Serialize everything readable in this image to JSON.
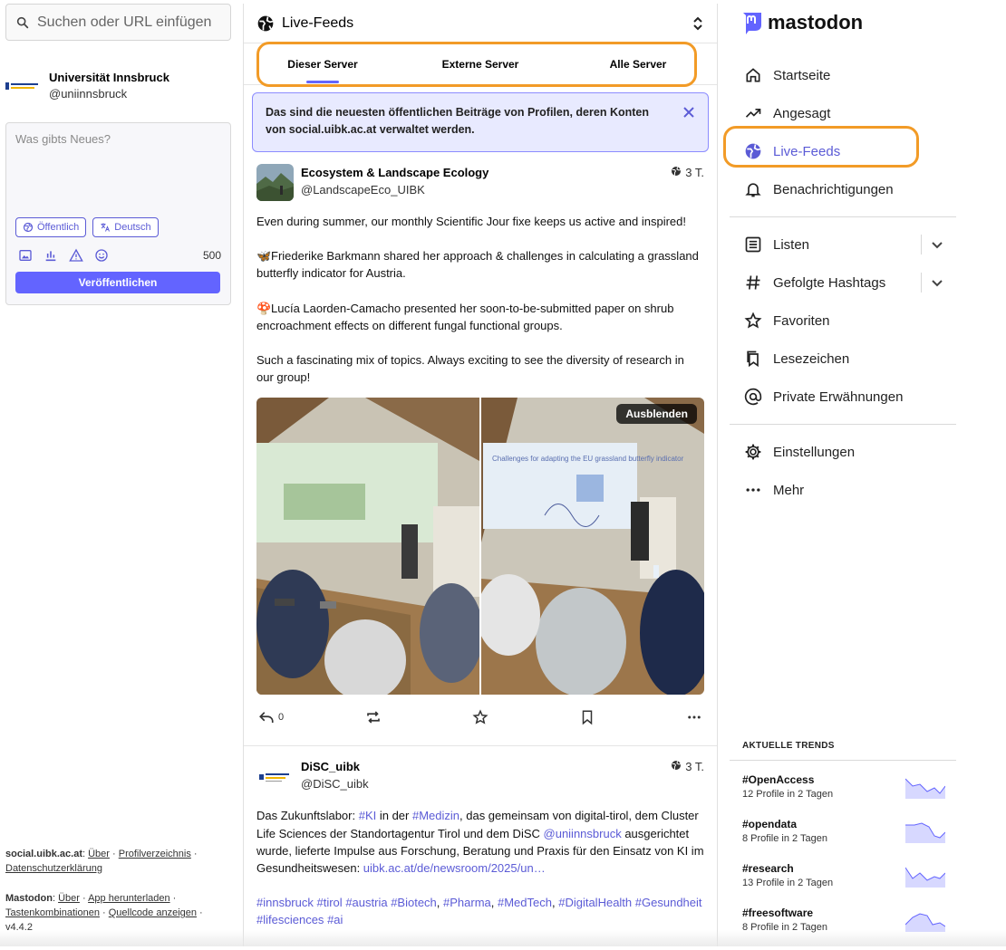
{
  "search": {
    "placeholder": "Suchen oder URL einfügen"
  },
  "account": {
    "name": "Universität Innsbruck",
    "handle": "@uniinnsbruck",
    "logo_text": "universität innsbruck"
  },
  "compose": {
    "placeholder": "Was gibts Neues?",
    "visibility_label": "Öffentlich",
    "language_label": "Deutsch",
    "char_count": "500",
    "publish_label": "Veröffentlichen"
  },
  "footer": {
    "server_name": "social.uibk.ac.at",
    "server_links": [
      "Über",
      "Profilverzeichnis",
      "Datenschutzerklärung"
    ],
    "mastodon_name": "Mastodon",
    "mastodon_links": [
      "Über",
      "App herunterladen",
      "Tastenkombinationen",
      "Quellcode anzeigen"
    ],
    "version": "v4.4.2"
  },
  "column": {
    "title": "Live-Feeds",
    "tabs": [
      {
        "label": "Dieser Server",
        "active": true
      },
      {
        "label": "Externe Server",
        "active": false
      },
      {
        "label": "Alle Server",
        "active": false
      }
    ],
    "banner_text": "Das sind die neuesten öffentlichen Beiträge von Profilen, deren Konten von social.uibk.ac.at verwaltet werden."
  },
  "posts": [
    {
      "author": "Ecosystem & Landscape Ecology",
      "handle": "@LandscapeEco_UIBK",
      "age": "3 T.",
      "paragraphs": [
        "Even during summer, our monthly Scientific Jour fixe keeps us active and inspired!",
        "Friederike Barkmann shared her approach & challenges in calculating a grassland butterfly indicator for Austria.",
        "Lucía Laorden-Camacho presented her soon-to-be-submitted paper on shrub encroachment effects on different fungal functional groups.",
        "Such a fascinating mix of topics. Always exciting to see the diversity of research in our group!"
      ],
      "emojis": [
        "🦋",
        "🍄"
      ],
      "media_hide_label": "Ausblenden",
      "slide_title": "Challenges for adapting the EU grassland butterfly indicator",
      "reply_count": "0"
    },
    {
      "author": "DiSC_uibk",
      "handle": "@DiSC_uibk",
      "age": "3 T.",
      "text_parts": {
        "t1": "Das Zukunftslabor: ",
        "ki": "#KI",
        "t2": " in der ",
        "medizin": "#Medizin",
        "t3": ", das gemeinsam von digital-tirol, dem Cluster Life Sciences der Standortagentur Tirol und dem DiSC ",
        "mention": "@uniinnsbruck",
        "t4": " ausgerichtet wurde, lieferte Impulse aus Forschung, Beratung und Praxis für den Einsatz von KI im Gesundheitswesen: ",
        "link": "uibk.ac.at/de/newsroom/2025/un…"
      },
      "hashtags": [
        "#innsbruck",
        "#tirol",
        "#austria",
        "#Biotech",
        "#Pharma",
        "#MedTech",
        "#DigitalHealth",
        "#Gesundheit",
        "#lifesciences",
        "#ai"
      ]
    }
  ],
  "nav": {
    "brand": "mastodon",
    "items": [
      {
        "label": "Startseite",
        "icon": "home-icon"
      },
      {
        "label": "Angesagt",
        "icon": "trending-icon"
      },
      {
        "label": "Live-Feeds",
        "icon": "globe-icon",
        "active": true
      },
      {
        "label": "Benachrichtigungen",
        "icon": "bell-icon"
      },
      {
        "label": "Listen",
        "icon": "list-icon"
      },
      {
        "label": "Gefolgte Hashtags",
        "icon": "hashtag-icon"
      },
      {
        "label": "Favoriten",
        "icon": "star-icon"
      },
      {
        "label": "Lesezeichen",
        "icon": "bookmarks-icon"
      },
      {
        "label": "Private Erwähnungen",
        "icon": "at-icon"
      },
      {
        "label": "Einstellungen",
        "icon": "gear-icon"
      },
      {
        "label": "Mehr",
        "icon": "more-icon"
      }
    ]
  },
  "trends": {
    "title": "AKTUELLE TRENDS",
    "items": [
      {
        "tag": "#OpenAccess",
        "stat": "12 Profile in 2 Tagen"
      },
      {
        "tag": "#opendata",
        "stat": "8 Profile in 2 Tagen"
      },
      {
        "tag": "#research",
        "stat": "13 Profile in 2 Tagen"
      },
      {
        "tag": "#freesoftware",
        "stat": "8 Profile in 2 Tagen"
      }
    ]
  },
  "colors": {
    "accent": "#6364ff",
    "highlight": "#f29b27",
    "banner_bg": "#e8eaff"
  }
}
